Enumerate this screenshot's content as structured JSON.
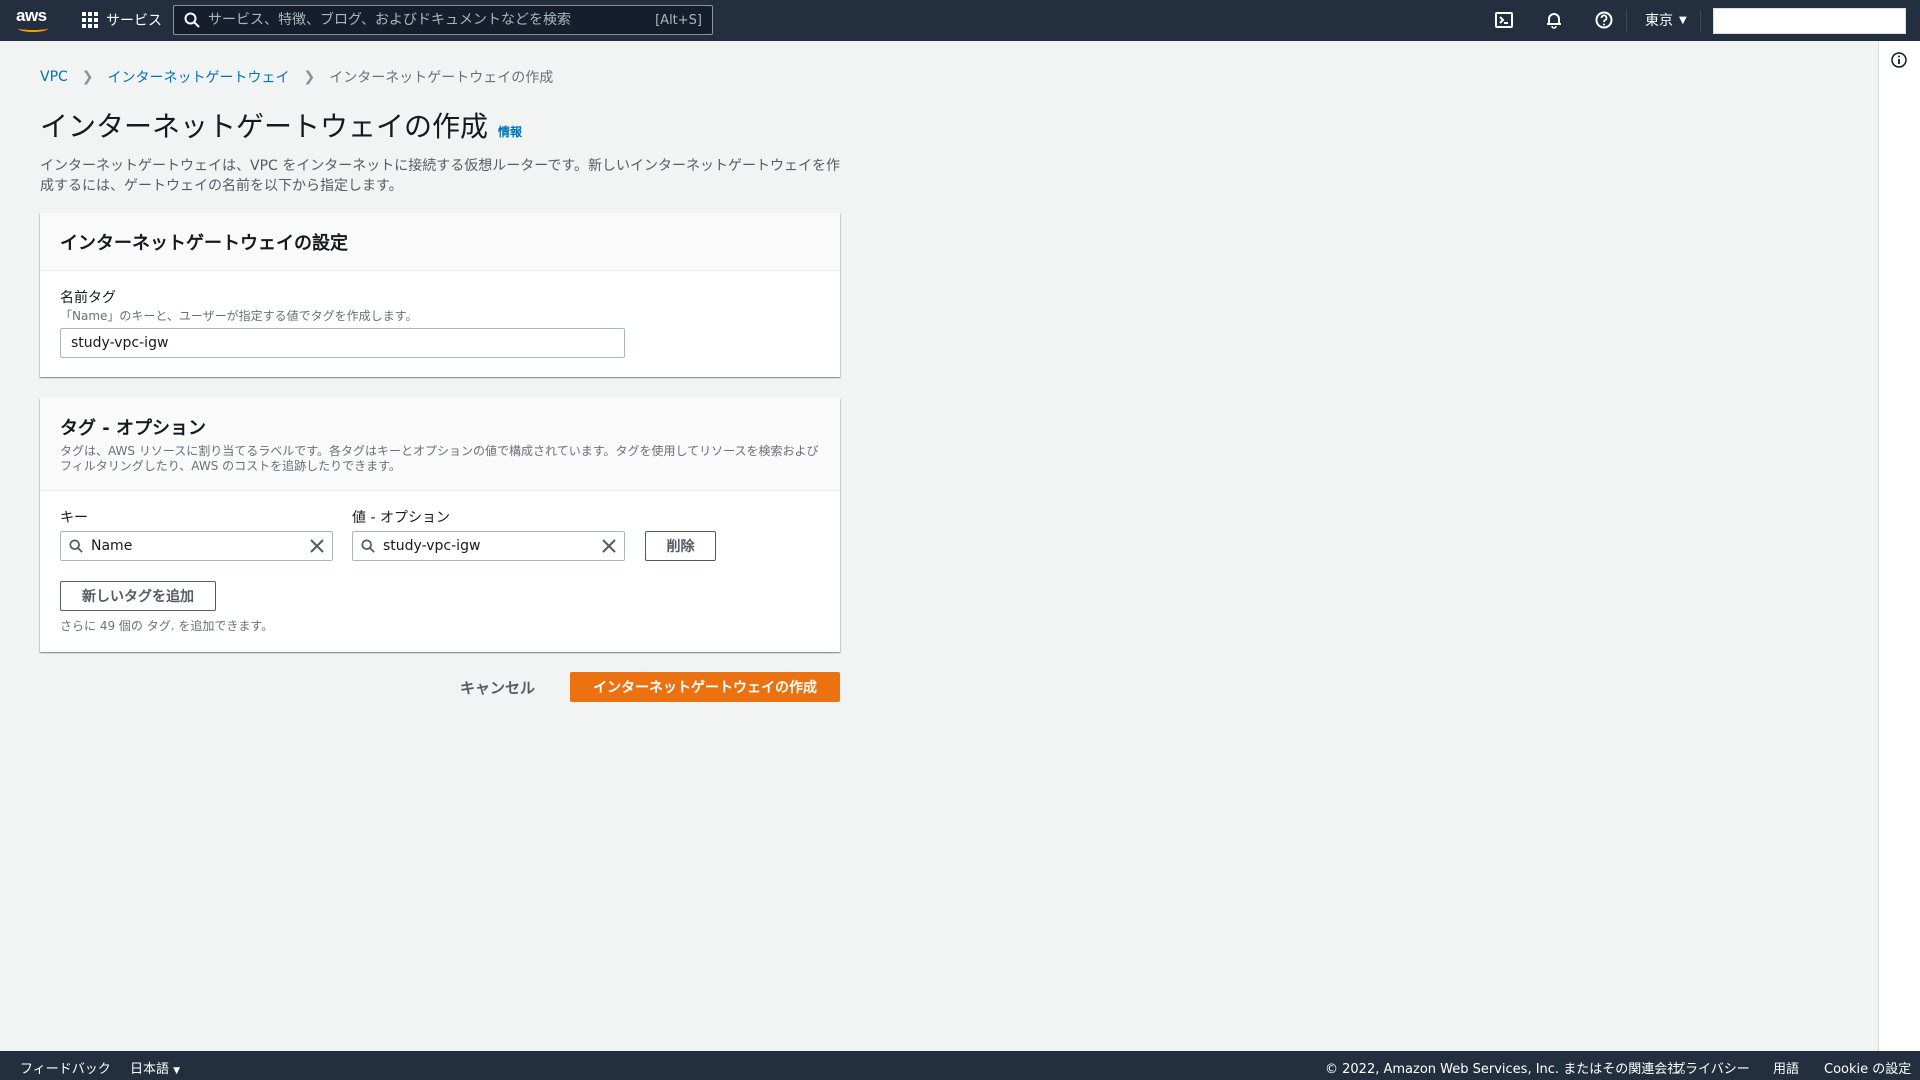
{
  "topnav": {
    "services_label": "サービス",
    "search_placeholder": "サービス、特徴、ブログ、およびドキュメントなどを検索",
    "search_shortcut": "[Alt+S]",
    "region": "東京"
  },
  "breadcrumb": {
    "items": [
      "VPC",
      "インターネットゲートウェイ",
      "インターネットゲートウェイの作成"
    ]
  },
  "page": {
    "title": "インターネットゲートウェイの作成",
    "info_link": "情報",
    "description": "インターネットゲートウェイは、VPC をインターネットに接続する仮想ルーターです。新しいインターネットゲートウェイを作成するには、ゲートウェイの名前を以下から指定します。"
  },
  "settings_panel": {
    "title": "インターネットゲートウェイの設定",
    "name_tag_label": "名前タグ",
    "name_tag_desc": "「Name」のキーと、ユーザーが指定する値でタグを作成します。",
    "name_tag_value": "study-vpc-igw"
  },
  "tags_panel": {
    "title": "タグ - オプション",
    "description": "タグは、AWS リソースに割り当てるラベルです。各タグはキーとオプションの値で構成されています。タグを使用してリソースを検索およびフィルタリングしたり、AWS のコストを追跡したりできます。",
    "key_label": "キー",
    "value_label": "値 - オプション",
    "key_value": "Name",
    "value_value": "study-vpc-igw",
    "remove_label": "削除",
    "add_tag_label": "新しいタグを追加",
    "remaining_text": "さらに 49 個の タグ. を追加できます。"
  },
  "actions": {
    "cancel_label": "キャンセル",
    "create_label": "インターネットゲートウェイの作成"
  },
  "footer": {
    "feedback": "フィードバック",
    "language": "日本語",
    "copyright": "© 2022, Amazon Web Services, Inc. またはその関連会社。",
    "privacy": "プライバシー",
    "terms": "用語",
    "cookie": "Cookie の設定"
  },
  "colors": {
    "nav_bg": "#232f3e",
    "primary": "#ec7211",
    "link": "#0073bb"
  }
}
